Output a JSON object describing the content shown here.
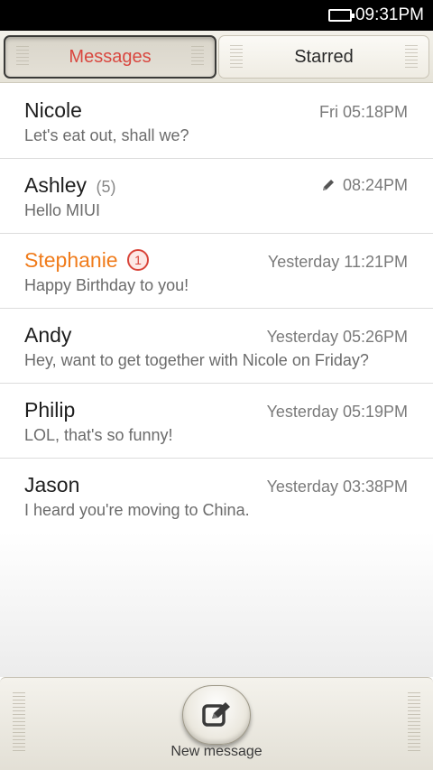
{
  "status_bar": {
    "time": "09:31PM"
  },
  "tabs": [
    {
      "label": "Messages",
      "active": true
    },
    {
      "label": "Starred",
      "active": false
    }
  ],
  "threads": [
    {
      "name": "Nicole",
      "count": "",
      "unread_badge": "",
      "time": "Fri 05:18PM",
      "snippet": "Let's eat out, shall we?",
      "draft": false,
      "unread": false
    },
    {
      "name": "Ashley",
      "count": "(5)",
      "unread_badge": "",
      "time": "08:24PM",
      "snippet": "Hello MIUI",
      "draft": true,
      "unread": false
    },
    {
      "name": "Stephanie",
      "count": "",
      "unread_badge": "1",
      "time": "Yesterday 11:21PM",
      "snippet": "Happy Birthday to you!",
      "draft": false,
      "unread": true
    },
    {
      "name": "Andy",
      "count": "",
      "unread_badge": "",
      "time": "Yesterday 05:26PM",
      "snippet": "Hey, want to get together with Nicole on Friday?",
      "draft": false,
      "unread": false
    },
    {
      "name": "Philip",
      "count": "",
      "unread_badge": "",
      "time": "Yesterday 05:19PM",
      "snippet": "LOL, that's so funny!",
      "draft": false,
      "unread": false
    },
    {
      "name": "Jason",
      "count": "",
      "unread_badge": "",
      "time": "Yesterday 03:38PM",
      "snippet": "I heard you're moving to China.",
      "draft": false,
      "unread": false
    }
  ],
  "bottom_bar": {
    "new_message_label": "New message",
    "icon": "compose-icon"
  },
  "colors": {
    "accent": "#d9473f",
    "unread_name": "#f07c1c",
    "badge": "#d9453a"
  }
}
